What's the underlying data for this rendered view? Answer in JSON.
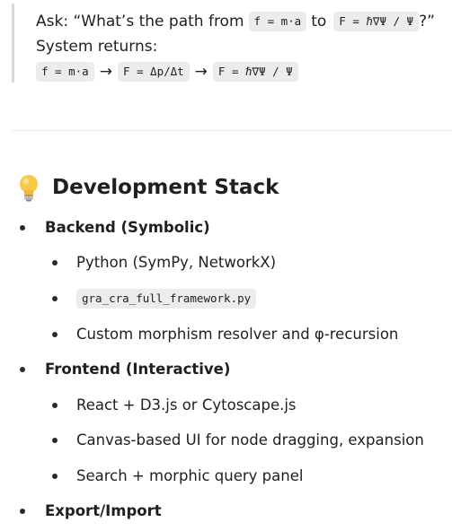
{
  "quote": {
    "ask_prefix": "Ask: “What’s the path from",
    "ask_code1": "f = m·a",
    "ask_to": "to",
    "ask_code2": "F = ℏ∇Ψ / Ψ",
    "ask_suffix": "?”",
    "system_returns": "System returns:",
    "path": [
      "f = m·a",
      "F = Δp/Δt",
      "F = ℏ∇Ψ / Ψ"
    ],
    "arrow": "→"
  },
  "section": {
    "icon": "light-bulb-icon",
    "title": "Development Stack"
  },
  "list": {
    "backend": {
      "label": "Backend (Symbolic)",
      "items": [
        "Python (SymPy, NetworkX)",
        "gra_cra_full_framework.py",
        "Custom morphism resolver and φ-recursion"
      ]
    },
    "frontend": {
      "label": "Frontend (Interactive)",
      "items": [
        "React + D3.js or Cytoscape.js",
        "Canvas-based UI for node dragging, expansion",
        "Search + morphic query panel"
      ]
    },
    "export": {
      "label": "Export/Import"
    }
  }
}
